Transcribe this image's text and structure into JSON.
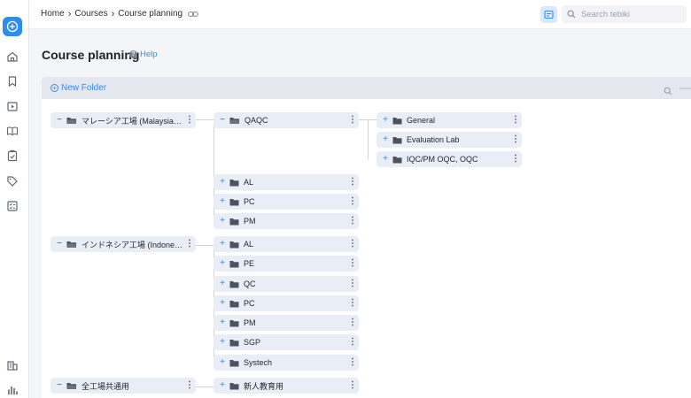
{
  "breadcrumb": [
    "Home",
    "Courses",
    "Course planning"
  ],
  "search": {
    "placeholder": "Search tebiki"
  },
  "page": {
    "title": "Course planning",
    "help_label": "Help"
  },
  "toolbar": {
    "new_folder_label": "New Folder"
  },
  "sidebar": {
    "items": [
      "home-icon",
      "bookmark-icon",
      "video-icon",
      "book-icon",
      "clipboard-icon",
      "tag-icon",
      "checklist-icon",
      "building-icon",
      "bar-chart-icon"
    ]
  },
  "tree": {
    "roots": [
      {
        "label": "マレーシア工場 (Malaysia Pla…",
        "expanded": true,
        "children": [
          {
            "label": "QAQC",
            "expanded": true,
            "children": [
              "General",
              "Evaluation Lab",
              "IQC/PM OQC, OQC"
            ]
          },
          {
            "label": "AL",
            "expanded": false
          },
          {
            "label": "PC",
            "expanded": false
          },
          {
            "label": "PM",
            "expanded": false
          }
        ]
      },
      {
        "label": "インドネシア工場 (Indonesia …",
        "expanded": true,
        "children": [
          {
            "label": "AL"
          },
          {
            "label": "PE"
          },
          {
            "label": "QC"
          },
          {
            "label": "PC"
          },
          {
            "label": "PM"
          },
          {
            "label": "SGP"
          },
          {
            "label": "Systech"
          }
        ]
      },
      {
        "label": "全工場共通用",
        "expanded": true,
        "children": [
          {
            "label": "新人教育用"
          }
        ]
      }
    ]
  },
  "colors": {
    "accent": "#2f8cf0",
    "node_bg": "#e9edf5",
    "toolbar_bg": "#e4e7ee"
  }
}
